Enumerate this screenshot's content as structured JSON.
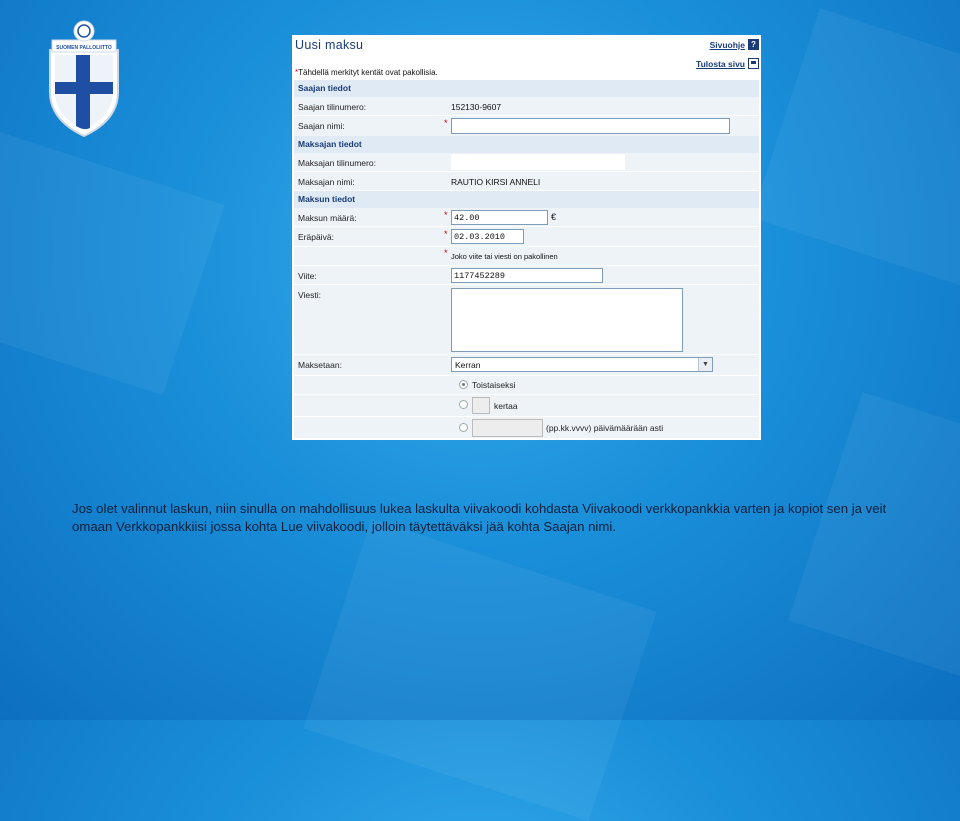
{
  "window": {
    "title": "Uusi maksu"
  },
  "toplinks": {
    "help": "Sivuohje",
    "print": "Tulosta sivu",
    "help_glyph": "?"
  },
  "required_note": "Tähdellä merkityt kentät ovat pakollisia.",
  "asterisk": "*",
  "sections": {
    "payee": "Saajan tiedot",
    "payer": "Maksajan tiedot",
    "payment": "Maksun tiedot"
  },
  "fields": {
    "payee_account_label": "Saajan tilinumero:",
    "payee_account_value": "152130-9607",
    "payee_name_label": "Saajan nimi:",
    "payee_name_value": "",
    "payer_account_label": "Maksajan tilinumero:",
    "payer_name_label": "Maksajan nimi:",
    "payer_name_value": "RAUTIO KIRSI ANNELI",
    "amount_label": "Maksun määrä:",
    "amount_value": "42.00",
    "currency": "€",
    "due_label": "Eräpäivä:",
    "due_value": "02.03.2010",
    "ref_note": "Joko viite tai viesti on pakollinen",
    "ref_label": "Viite:",
    "ref_value": "1177452289",
    "message_label": "Viesti:",
    "message_value": "",
    "repeat_label": "Maksetaan:",
    "repeat_value": "Kerran",
    "radio_until_further": "Toistaiseksi",
    "radio_times": "kertaa",
    "radio_until_date": "(pp.kk.vvvv) päivämäärään asti"
  },
  "caption": "Jos olet valinnut laskun, niin sinulla on mahdollisuus lukea laskulta viivakoodi  kohdasta Viivakoodi verkkopankkia varten ja kopiot sen ja veit omaan Verkkopankkiisi jossa kohta Lue viivakoodi, jolloin täytettäväksi jää kohta Saajan nimi.",
  "logo": {
    "text": "SUOMEN PALLOLIITTO"
  }
}
